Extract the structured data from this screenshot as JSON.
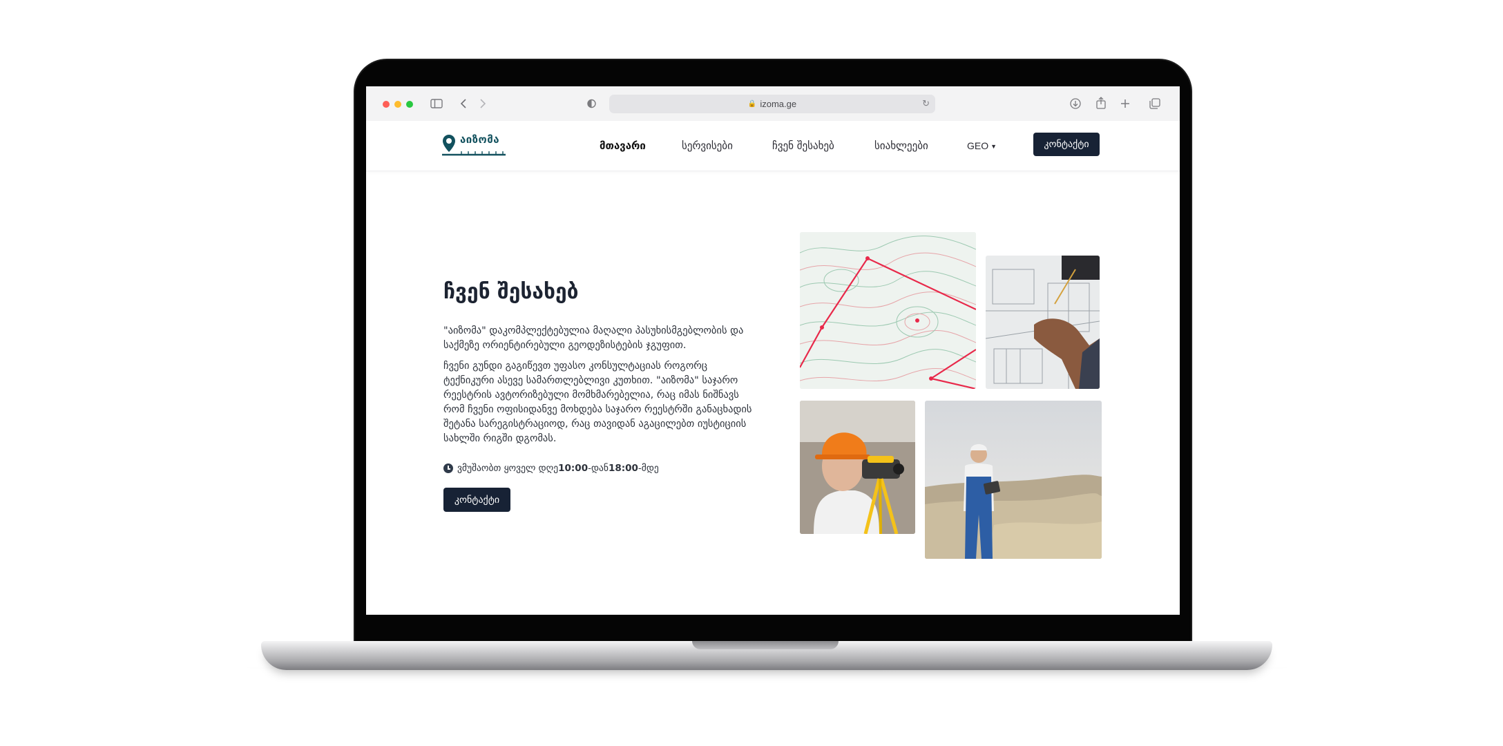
{
  "browser": {
    "url": "izoma.ge"
  },
  "nav": {
    "logo_text": "აიზომა",
    "items": [
      {
        "label": "მთავარი",
        "active": true
      },
      {
        "label": "სერვისები",
        "active": false
      },
      {
        "label": "ჩვენ შესახებ",
        "active": false
      },
      {
        "label": "სიახლეები",
        "active": false
      }
    ],
    "language": "GEO",
    "contact_button": "კონტაქტი"
  },
  "about": {
    "title": "ჩვენ შესახებ",
    "paragraph1": "\"აიზომა\" დაკომპლექტებულია მაღალი პასუხისმგებლობის და საქმეზე ორიენტირებული გეოდეზისტების ჯგუფით.",
    "paragraph2": "ჩვენი გუნდი გაგიწევთ უფასო კონსულტაციას როგორც ტექნიკური ასევე სამართლებლივი კუთხით. \"აიზომა\" საჯარო რეესტრის ავტორიზებული მომხმარებელია, რაც იმას ნიშნავს რომ ჩვენი ოფისიდანვე მოხდება საჯარო რეესტრში განაცხადის შეტანა სარეგისტრაციოდ, რაც თავიდან აგაცილებთ იუსტიციის სახლში რიგში დგომას.",
    "hours_prefix": "ვმუშაობთ ყოველ დღე ",
    "hours_from": "10:00",
    "hours_mid": "-დან ",
    "hours_to": "18:00",
    "hours_suffix": "-მდე",
    "contact_button": "კონტაქტი"
  },
  "icons": [
    "clock-icon",
    "sidebar-icon",
    "back-icon",
    "forward-icon",
    "shield-icon",
    "lock-icon",
    "reload-icon",
    "download-icon",
    "share-icon",
    "new-tab-icon",
    "tabs-icon",
    "location-pin-icon"
  ],
  "colors": {
    "primary_button": "#172235",
    "logo": "#12515e",
    "survey_line": "#e8294a"
  }
}
